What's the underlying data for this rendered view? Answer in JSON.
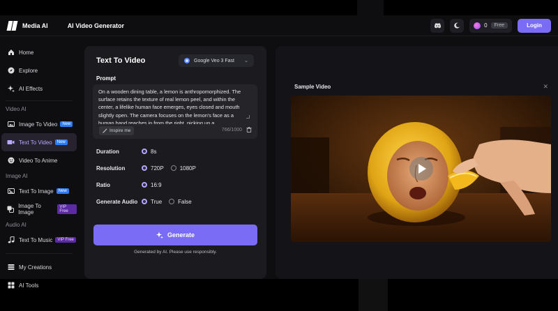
{
  "header": {
    "brand": "Media AI",
    "title": "AI Video Generator",
    "credits": "0",
    "free_tag": "Free",
    "login": "Login"
  },
  "sidebar": {
    "top_items": [
      {
        "label": "Home",
        "icon": "home-icon"
      },
      {
        "label": "Explore",
        "icon": "compass-icon"
      },
      {
        "label": "AI Effects",
        "icon": "sparkle-icon"
      }
    ],
    "sections": [
      {
        "title": "Video AI",
        "items": [
          {
            "label": "Image To Video",
            "badge": "New",
            "badge_type": "new",
            "icon": "image-icon"
          },
          {
            "label": "Text To Video",
            "badge": "New",
            "badge_type": "new",
            "icon": "video-icon",
            "active": true
          },
          {
            "label": "Video To Anime",
            "icon": "anime-icon"
          }
        ]
      },
      {
        "title": "Image AI",
        "items": [
          {
            "label": "Text To Image",
            "badge": "New",
            "badge_type": "new",
            "icon": "image-icon"
          },
          {
            "label": "Image To Image",
            "badge": "VIP Free",
            "badge_type": "vip",
            "icon": "image-swap-icon"
          }
        ]
      },
      {
        "title": "Audio AI",
        "items": [
          {
            "label": "Text To Music",
            "badge": "VIP Free",
            "badge_type": "vip",
            "icon": "music-icon"
          }
        ]
      }
    ],
    "bottom_items": [
      {
        "label": "My Creations",
        "icon": "folder-icon"
      },
      {
        "label": "AI Tools",
        "icon": "grid-icon"
      }
    ]
  },
  "form": {
    "title": "Text To Video",
    "model": "Google Veo 3 Fast",
    "prompt_label": "Prompt",
    "prompt_text": "On a wooden dining table, a lemon is anthropomorphized. The surface retains the texture of real lemon peel, and within the center, a lifelike human face emerges, eyes closed and mouth slightly open. The camera focuses on the lemon's face as a human hand reaches in from the right, picking up a",
    "inspire": "Inspire me",
    "char_count": "766/1000",
    "options": {
      "duration": {
        "label": "Duration",
        "values": [
          "8s"
        ],
        "selected": "8s"
      },
      "resolution": {
        "label": "Resolution",
        "values": [
          "720P",
          "1080P"
        ],
        "selected": "720P"
      },
      "ratio": {
        "label": "Ratio",
        "values": [
          "16:9"
        ],
        "selected": "16:9"
      },
      "audio": {
        "label": "Generate Audio",
        "values": [
          "True",
          "False"
        ],
        "selected": "True"
      }
    },
    "generate": "Generate",
    "disclaimer": "Generated by AI. Please use responsibly."
  },
  "sample": {
    "title": "Sample Video"
  },
  "colors": {
    "accent": "#7b6cf6",
    "background": "#0e0e11",
    "panel": "#1a1a1f"
  }
}
